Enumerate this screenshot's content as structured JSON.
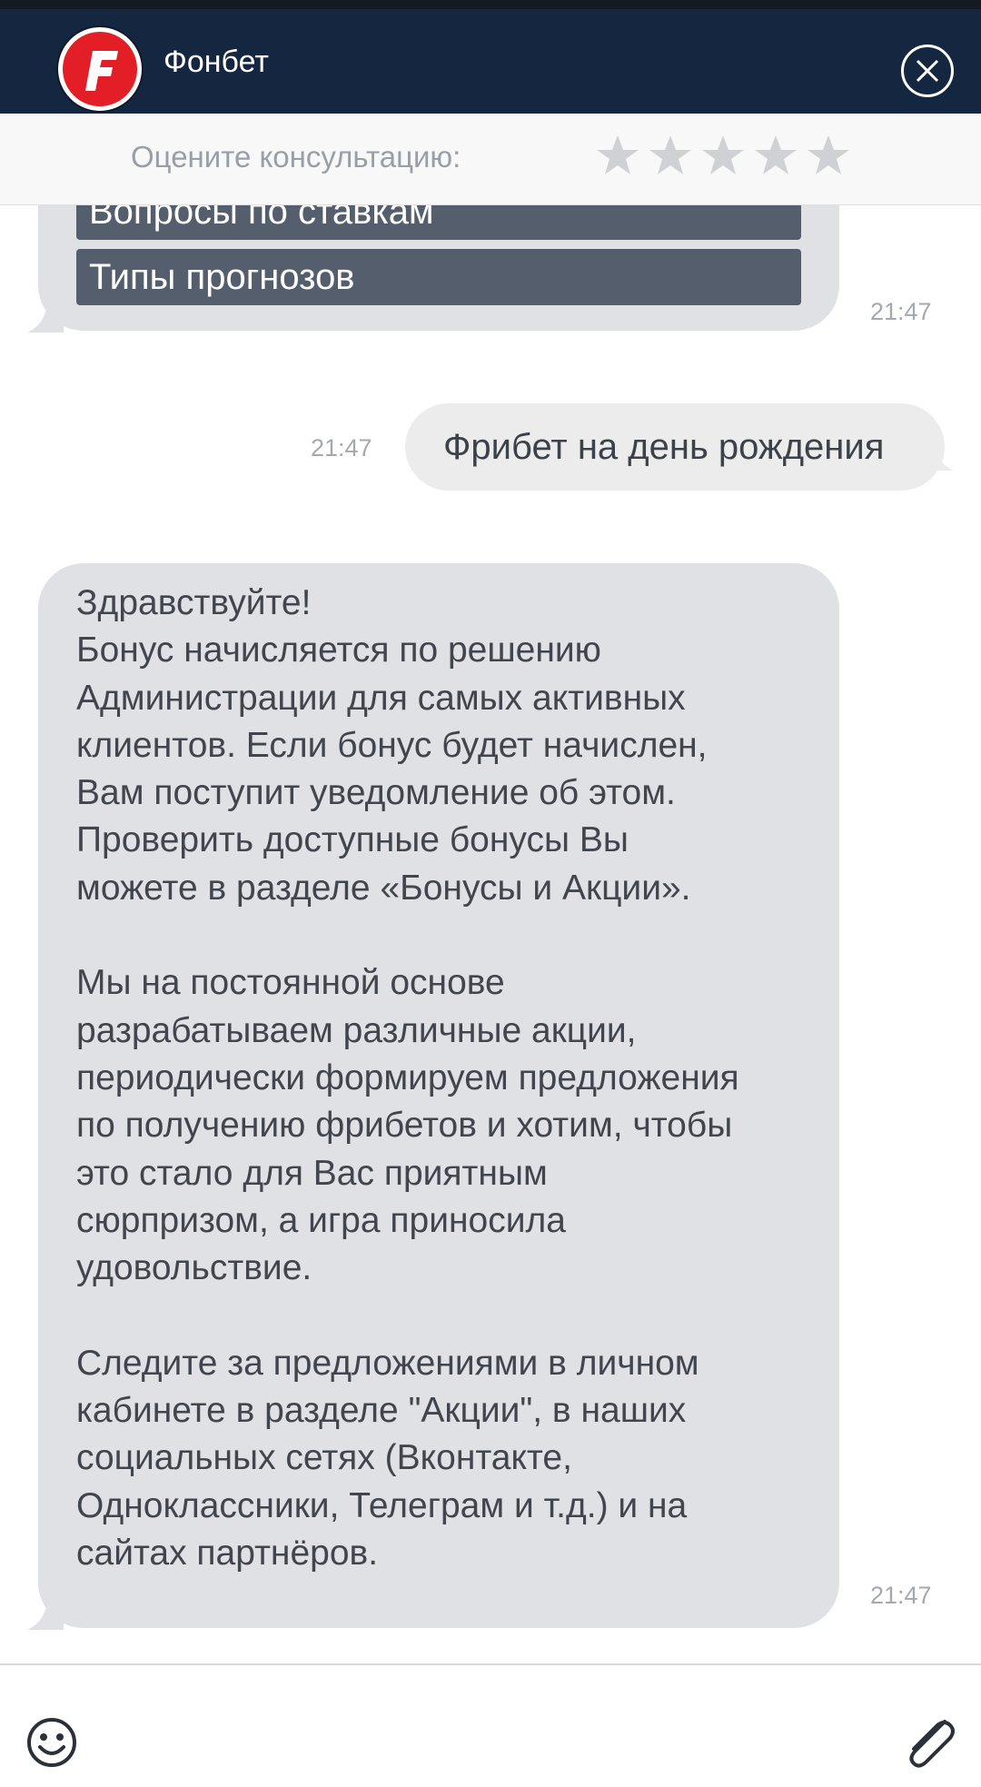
{
  "header": {
    "app_name": "Фонбет",
    "logo_letter": "F",
    "brand_color": "#e41e26",
    "background": "#152740",
    "close_icon": "close-icon"
  },
  "rating": {
    "label": "Оцените консультацию:",
    "stars_total": 5,
    "stars_selected": 0
  },
  "messages": [
    {
      "from": "bot",
      "quick_replies": [
        "Вопросы по ставкам",
        "Типы прогнозов"
      ],
      "time": "21:47"
    },
    {
      "from": "user",
      "text": "Фрибет на день рождения",
      "time": "21:47"
    },
    {
      "from": "bot",
      "paragraphs": [
        [
          "Здравствуйте!",
          "Бонус начисляется по решению",
          "Администрации для самых активных",
          "клиентов. Если бонус будет начислен,",
          "Вам поступит уведомление об этом.",
          "Проверить доступные бонусы Вы",
          "можете в разделе «Бонусы и Акции»."
        ],
        [
          "Мы на постоянной основе",
          "разрабатываем различные акции,",
          "периодически формируем предложения",
          "по получению фрибетов и хотим, чтобы",
          "это стало для Вас приятным",
          "сюрпризом, а игра приносила",
          "удовольствие."
        ],
        [
          "Следите за предложениями в личном",
          "кабинете в разделе \"Акции\", в наших",
          "социальных сетях (Вконтакте,",
          "Одноклассники, Телеграм и т.д.) и на",
          "сайтах партнёров."
        ]
      ],
      "time": "21:47"
    }
  ],
  "composer": {
    "emoji_icon": "smiley-icon",
    "attach_icon": "paperclip-icon"
  }
}
